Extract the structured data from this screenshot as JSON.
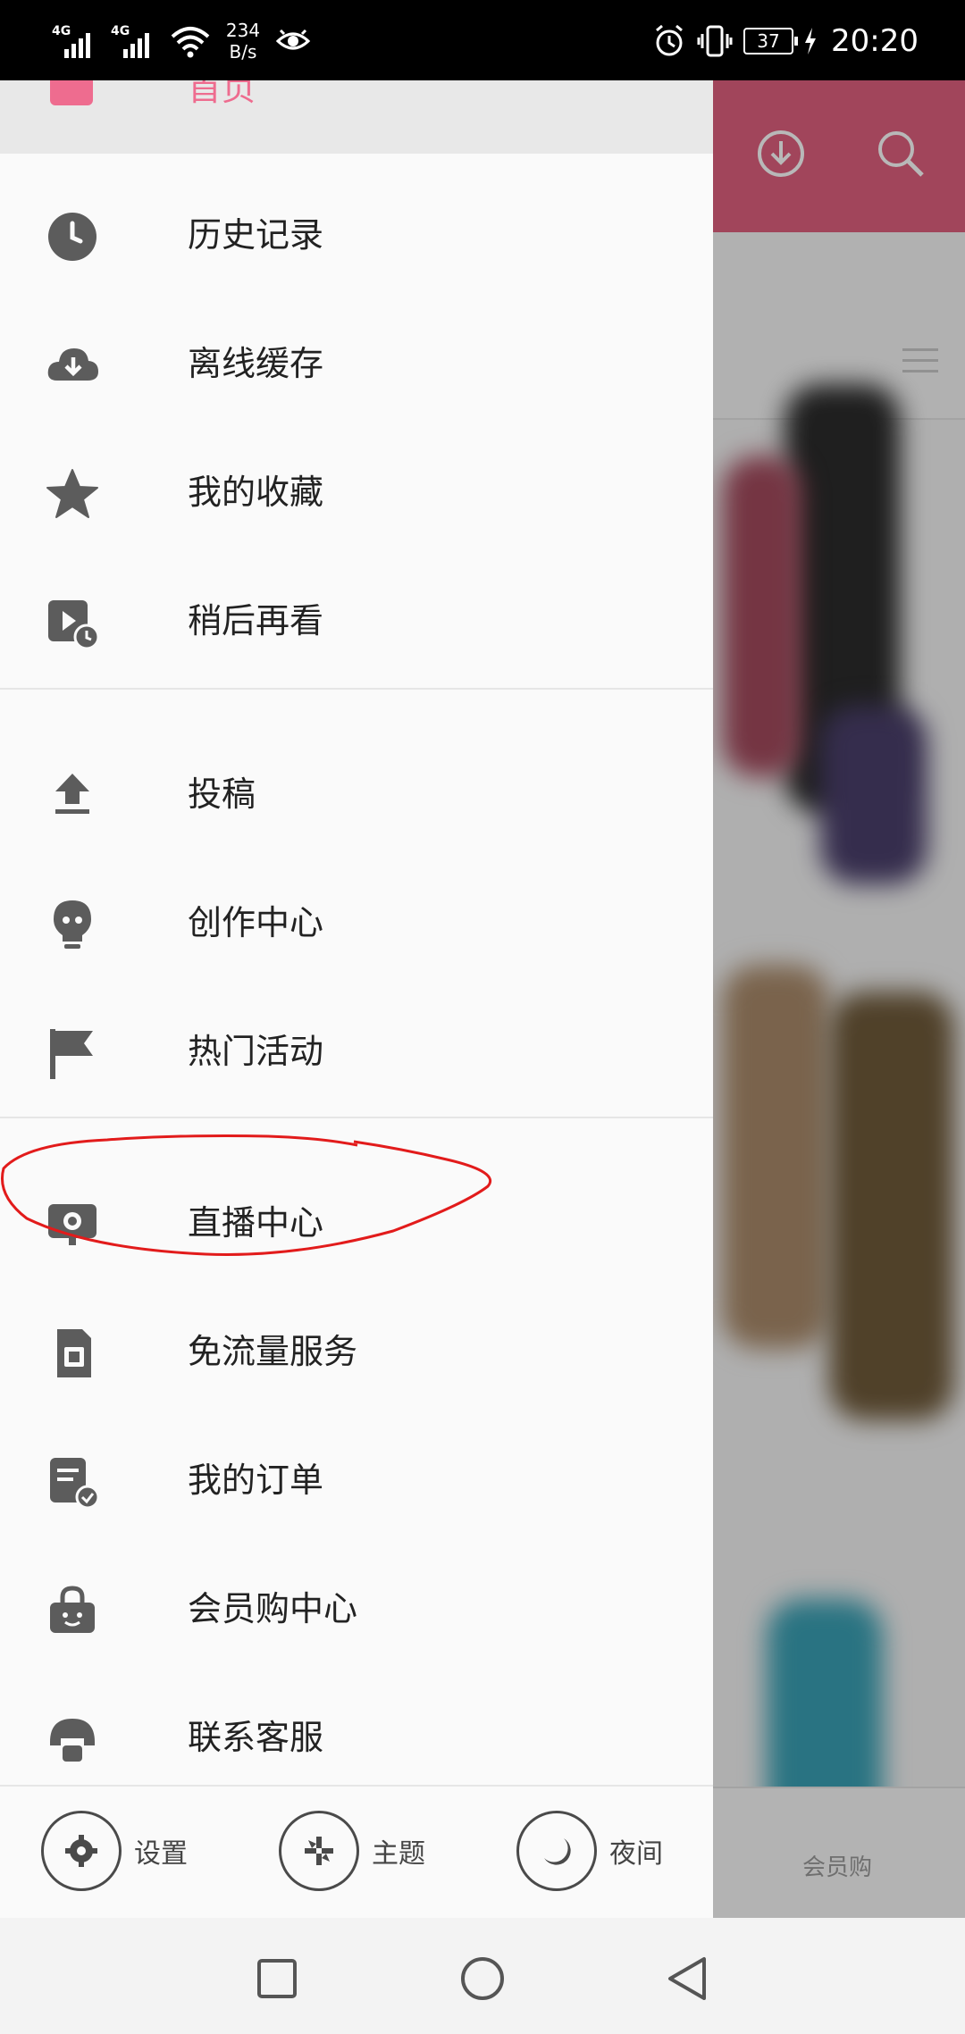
{
  "status_bar": {
    "network1": "4G",
    "network2": "4G",
    "speed_value": "234",
    "speed_unit": "B/s",
    "battery": "37",
    "time": "20:20",
    "icons": [
      "signal-icon",
      "wifi-icon",
      "eye-icon",
      "alarm-icon",
      "vibrate-icon",
      "battery-icon",
      "charging-icon"
    ]
  },
  "drawer": {
    "home_label": "首页",
    "items": [
      {
        "label": "历史记录",
        "icon": "history-clock-icon"
      },
      {
        "label": "离线缓存",
        "icon": "cloud-download-icon"
      },
      {
        "label": "我的收藏",
        "icon": "star-icon"
      },
      {
        "label": "稍后再看",
        "icon": "watch-later-icon"
      },
      {
        "label": "投稿",
        "icon": "upload-icon"
      },
      {
        "label": "创作中心",
        "icon": "lightbulb-icon"
      },
      {
        "label": "热门活动",
        "icon": "flag-icon"
      },
      {
        "label": "直播中心",
        "icon": "live-tv-icon"
      },
      {
        "label": "免流量服务",
        "icon": "sim-card-icon"
      },
      {
        "label": "我的订单",
        "icon": "order-icon"
      },
      {
        "label": "会员购中心",
        "icon": "shopping-bag-icon"
      },
      {
        "label": "联系客服",
        "icon": "headset-icon"
      }
    ],
    "bottom": {
      "settings": "设置",
      "theme": "主题",
      "night": "夜间"
    }
  },
  "background": {
    "vip_label": "会员购"
  },
  "annotation": {
    "color": "#e21b1b"
  },
  "colors": {
    "accent": "#ee6c8f",
    "header_bg": "#e0607e"
  }
}
